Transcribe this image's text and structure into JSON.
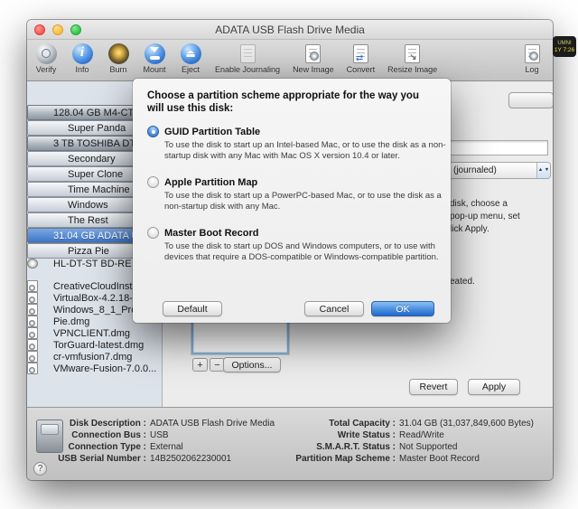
{
  "window": {
    "title": "ADATA USB Flash Drive Media"
  },
  "clock_badge": {
    "line1": "UMNI",
    "line2": "1Y 7:26"
  },
  "toolbar": {
    "items": [
      {
        "label": "Verify",
        "icon": "verify-icon"
      },
      {
        "label": "Info",
        "icon": "info-icon"
      },
      {
        "label": "Burn",
        "icon": "burn-icon"
      },
      {
        "label": "Mount",
        "icon": "mount-icon"
      },
      {
        "label": "Eject",
        "icon": "eject-icon"
      },
      {
        "label": "Enable Journaling",
        "icon": "journaling-icon"
      },
      {
        "label": "New Image",
        "icon": "new-image-icon"
      },
      {
        "label": "Convert",
        "icon": "convert-icon"
      },
      {
        "label": "Resize Image",
        "icon": "resize-image-icon"
      }
    ],
    "log_label": "Log",
    "eject_glyph": "⏏"
  },
  "sidebar": {
    "items": [
      {
        "label": "128.04 GB M4-CT1...",
        "icon": "disk-icon"
      },
      {
        "label": "Super Panda",
        "icon": "volume-icon",
        "indent": true
      },
      {
        "label": "3 TB TOSHIBA DT0...",
        "icon": "disk-icon"
      },
      {
        "label": "Secondary",
        "icon": "volume-icon",
        "indent": true
      },
      {
        "label": "Super Clone",
        "icon": "volume-icon",
        "indent": true
      },
      {
        "label": "Time Machine",
        "icon": "volume-icon",
        "indent": true
      },
      {
        "label": "Windows",
        "icon": "volume-icon",
        "indent": true
      },
      {
        "label": "The Rest",
        "icon": "volume-icon",
        "indent": true
      },
      {
        "label": "31.04 GB ADATA U...",
        "icon": "disk-icon",
        "selected": true
      },
      {
        "label": "Pizza Pie",
        "icon": "volume-icon",
        "indent": true
      },
      {
        "label": "HL-DT-ST BD-RE W...",
        "icon": "optical-icon"
      },
      {
        "label": "CreativeCloudInsta...",
        "icon": "dmg-icon",
        "gap_above": true
      },
      {
        "label": "VirtualBox-4.2.18-8...",
        "icon": "dmg-icon"
      },
      {
        "label": "Windows_8_1_Pro_...",
        "icon": "dmg-icon"
      },
      {
        "label": "Pie.dmg",
        "icon": "dmg-icon"
      },
      {
        "label": "VPNCLIENT.dmg",
        "icon": "dmg-icon"
      },
      {
        "label": "TorGuard-latest.dmg",
        "icon": "dmg-icon"
      },
      {
        "label": "cr-vmfusion7.dmg",
        "icon": "dmg-icon"
      },
      {
        "label": "VMware-Fusion-7.0.0...",
        "icon": "dmg-icon"
      }
    ]
  },
  "dialog": {
    "title": "Choose a partition scheme appropriate for the way you will use this disk:",
    "options": [
      {
        "label": "GUID Partition Table",
        "selected": true,
        "description": "To use the disk to start up an Intel-based Mac, or to use the disk as a non-startup disk with any Mac with Mac OS X version 10.4 or later."
      },
      {
        "label": "Apple Partition Map",
        "description": "To use the disk to start up a PowerPC-based Mac, or to use the disk as a non-startup disk with any Mac."
      },
      {
        "label": "Master Boot Record",
        "description": "To use the disk to start up DOS and Windows computers, or to use with devices that require a DOS-compatible or Windows-compatible partition."
      }
    ],
    "default_button": "Default",
    "cancel_button": "Cancel",
    "ok_button": "OK"
  },
  "main": {
    "format_fragment": "(journaled)",
    "popup_arrows": "▲\n▼",
    "fragments": [
      "disk, choose a",
      "pop-up menu, set",
      "lick Apply.",
      "eated."
    ],
    "add_label": "+",
    "remove_label": "−",
    "options_button": "Options...",
    "revert_button": "Revert",
    "apply_button": "Apply"
  },
  "info_panel": {
    "left": [
      {
        "label": "Disk Description :",
        "value": "ADATA USB Flash Drive Media"
      },
      {
        "label": "Connection Bus :",
        "value": "USB"
      },
      {
        "label": "Connection Type :",
        "value": "External"
      },
      {
        "label": "USB Serial Number :",
        "value": "14B2502062230001"
      }
    ],
    "right": [
      {
        "label": "Total Capacity :",
        "value": "31.04 GB (31,037,849,600 Bytes)"
      },
      {
        "label": "Write Status :",
        "value": "Read/Write"
      },
      {
        "label": "S.M.A.R.T. Status :",
        "value": "Not Supported"
      },
      {
        "label": "Partition Map Scheme :",
        "value": "Master Boot Record"
      }
    ]
  },
  "help_button": "?"
}
